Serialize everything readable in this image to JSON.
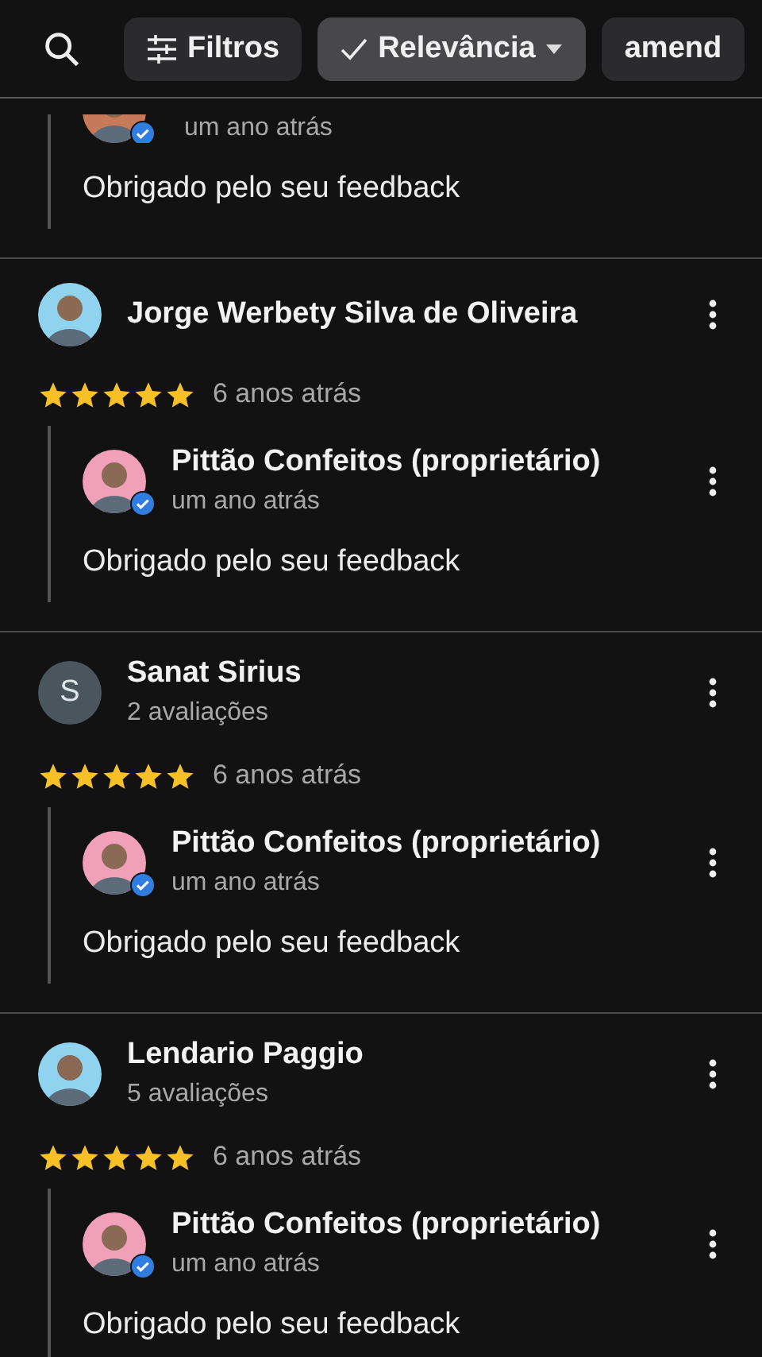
{
  "toolbar": {
    "chips": [
      {
        "label": "Filtros",
        "kind": "filter",
        "selected": false
      },
      {
        "label": "Relevância",
        "kind": "sort",
        "selected": true
      },
      {
        "label": "amend",
        "kind": "plain",
        "selected": false
      }
    ]
  },
  "reviews": [
    {
      "kind": "reply_only",
      "reply": {
        "time": "um ano atrás",
        "text": "Obrigado pelo seu feedback"
      }
    },
    {
      "kind": "full",
      "author": "Jorge Werbety Silva de Oliveira",
      "avatar": {
        "kind": "photo"
      },
      "stars": 5,
      "time": "6 anos atrás",
      "reply": {
        "author": "Pittão Confeitos (proprietário)",
        "time": "um ano atrás",
        "text": "Obrigado pelo seu feedback"
      }
    },
    {
      "kind": "full",
      "author": "Sanat Sirius",
      "subtitle": "2 avaliações",
      "avatar": {
        "kind": "letter",
        "letter": "S"
      },
      "stars": 5,
      "time": "6 anos atrás",
      "reply": {
        "author": "Pittão Confeitos (proprietário)",
        "time": "um ano atrás",
        "text": "Obrigado pelo seu feedback"
      }
    },
    {
      "kind": "full",
      "author": "Lendario Paggio",
      "subtitle": "5 avaliações",
      "avatar": {
        "kind": "photo"
      },
      "stars": 5,
      "time": "6 anos atrás",
      "reply": {
        "author": "Pittão Confeitos (proprietário)",
        "time": "um ano atrás",
        "text": "Obrigado pelo seu feedback"
      }
    }
  ]
}
